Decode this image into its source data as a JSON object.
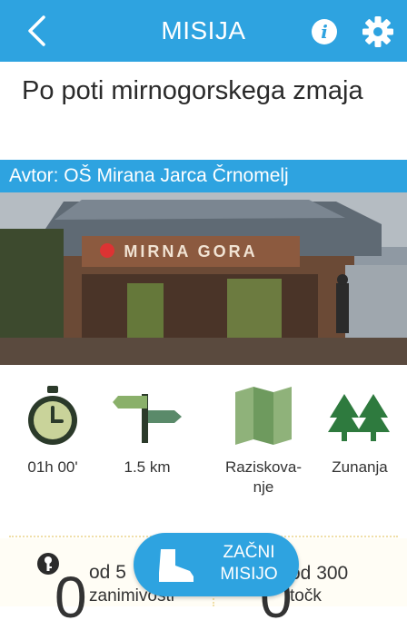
{
  "header": {
    "title": "MISIJA",
    "back_icon": "chevron-left-icon",
    "info_icon": "info-icon",
    "settings_icon": "gear-icon",
    "info_glyph": "i",
    "accent_color": "#2ea3e0"
  },
  "mission": {
    "title": "Po poti mirnogorskega zmaja",
    "author": "Avtor: OŠ Mirana Jarca Črnomelj",
    "photo_sign": "MIRNA GORA"
  },
  "stats": [
    {
      "icon": "stopwatch-icon",
      "label": "01h 00'"
    },
    {
      "icon": "signpost-icon",
      "label": "1.5 km"
    },
    {
      "icon": "map-icon",
      "label": "Raziskova-\nnje"
    },
    {
      "icon": "trees-icon",
      "label": "Zunanja"
    }
  ],
  "progress": {
    "points_of_interest": {
      "icon": "key-icon",
      "value": "0",
      "of": "od 5",
      "unit": "zanimivosti"
    },
    "points": {
      "value": "0",
      "of": "od 300",
      "unit": "točk"
    }
  },
  "start_button": {
    "label_line1": "ZAČNI",
    "label_line2": "MISIJO",
    "icon": "boot-icon"
  }
}
